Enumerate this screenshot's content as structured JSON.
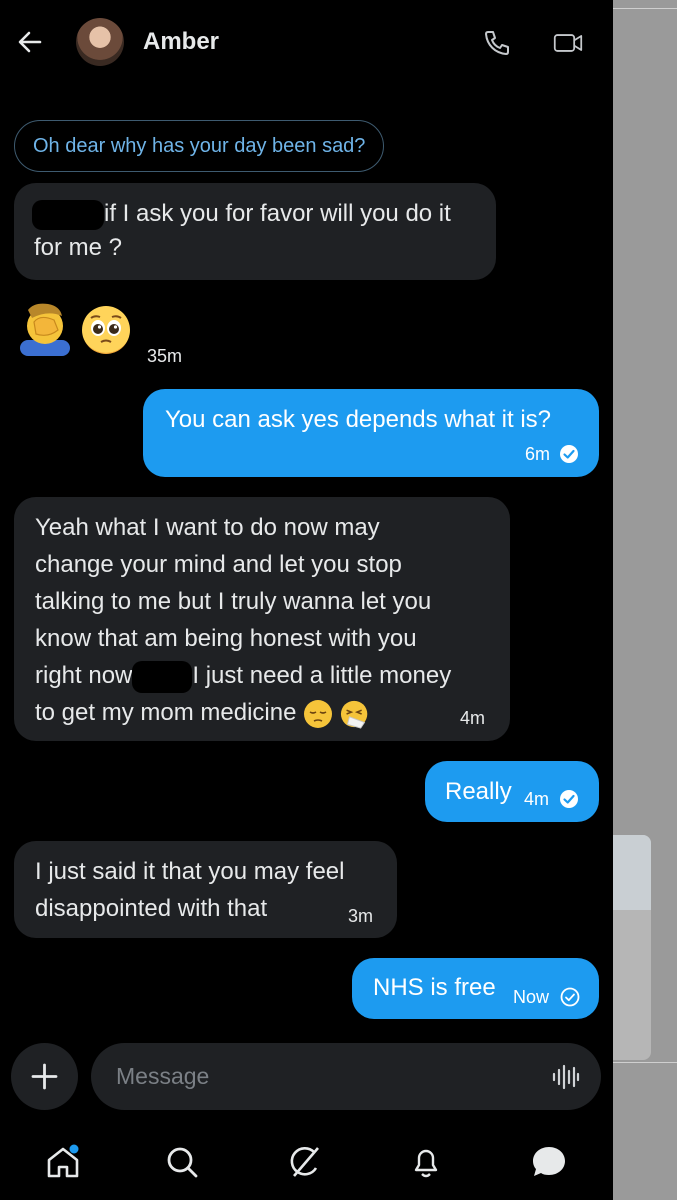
{
  "header": {
    "contact_name": "Amber",
    "icons": [
      "back-arrow-icon",
      "avatar",
      "phone-icon",
      "video-icon"
    ]
  },
  "reply_preview": "Oh dear why has your day been sad?",
  "messages": [
    {
      "direction": "in",
      "text_after_redaction": "if I ask you for favor will you do it",
      "line2": "for me ?"
    },
    {
      "direction": "in",
      "type": "emoji",
      "emojis": [
        "facepalm-emoji",
        "pleading-face-emoji"
      ],
      "time": "35m"
    },
    {
      "direction": "out",
      "text": "You can ask yes depends what it is?",
      "time": "6m",
      "status": "read"
    },
    {
      "direction": "in",
      "lines": [
        "Yeah what I want to do now may",
        "change your mind and let you stop",
        "talking to me but I truly wanna let you",
        "know that am being honest with you"
      ],
      "line5_before": "right now",
      "line5_after": "I just need a little money",
      "line6": "to get my mom medicine",
      "emojis": [
        "pensive-face-emoji",
        "sneezing-face-emoji"
      ],
      "time": "4m"
    },
    {
      "direction": "out",
      "text": "Really",
      "time": "4m",
      "status": "read"
    },
    {
      "direction": "in",
      "lines": [
        "I just said it that you may feel",
        "disappointed with that"
      ],
      "time": "3m"
    },
    {
      "direction": "out",
      "text": "NHS is free",
      "time": "Now",
      "status": "sent"
    }
  ],
  "composer": {
    "placeholder": "Message",
    "icons": [
      "plus-icon",
      "voice-waveform-icon"
    ]
  },
  "tabs": [
    "home-icon",
    "search-icon",
    "grok-icon",
    "notifications-icon",
    "messages-icon"
  ],
  "colors": {
    "accent": "#1d9bf0",
    "incoming_bubble": "#1f2124",
    "background": "#000000"
  }
}
